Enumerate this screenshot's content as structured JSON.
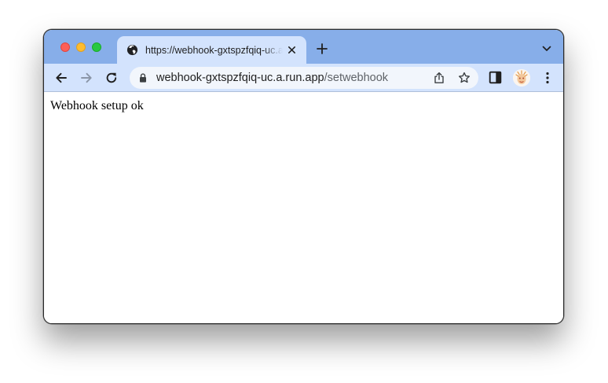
{
  "tab": {
    "title": "https://webhook-gxtspzfqiq-uc.a.run.app/setwebhook",
    "favicon_icon": "globe-icon",
    "close_icon": "close-icon"
  },
  "tabstrip": {
    "new_tab_icon": "plus-icon",
    "tab_search_icon": "chevron-down-icon"
  },
  "toolbar": {
    "back_icon": "arrow-left-icon",
    "forward_icon": "arrow-right-icon",
    "reload_icon": "reload-icon",
    "sidepanel_icon": "side-panel-icon",
    "menu_icon": "kebab-menu-icon"
  },
  "omnibox": {
    "host": "webhook-gxtspzfqiq-uc.a.run.app",
    "path": "/setwebhook",
    "lock_icon": "lock-icon",
    "share_icon": "share-icon",
    "bookmark_icon": "star-icon"
  },
  "page": {
    "body_text": "Webhook setup ok"
  },
  "colors": {
    "tabstrip_bg": "#87aee9",
    "toolbar_bg": "#d3e3fd",
    "omnibox_bg": "#f2f6fc"
  }
}
